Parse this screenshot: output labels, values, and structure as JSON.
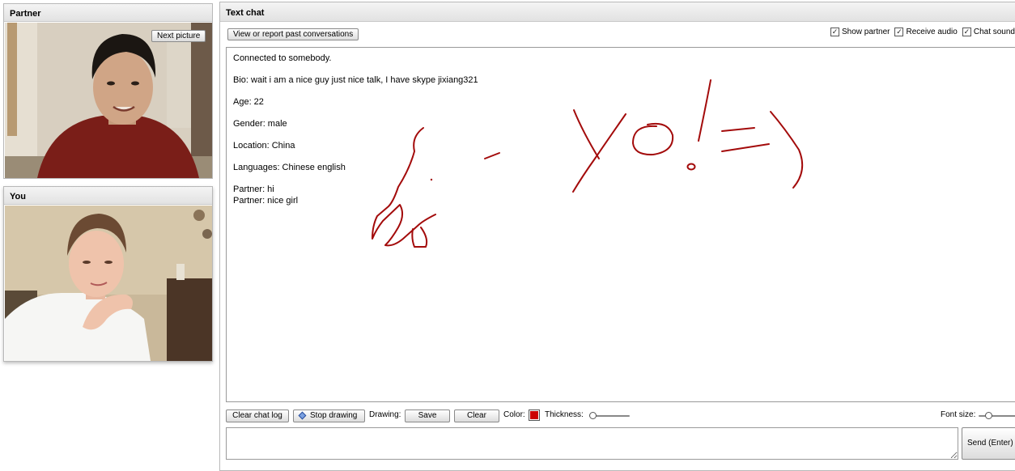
{
  "partner": {
    "title": "Partner",
    "next_picture_label": "Next picture"
  },
  "you": {
    "title": "You"
  },
  "chat": {
    "title": "Text chat",
    "history_button": "View or report past conversations",
    "options": [
      {
        "label": "Show partner",
        "checked": true
      },
      {
        "label": "Receive audio",
        "checked": true
      },
      {
        "label": "Chat sound",
        "checked": true
      }
    ],
    "log": {
      "connected": "Connected to somebody.",
      "bio": "Bio: wait i am a nice guy just nice talk, I have skype jixiang321",
      "age": "Age: 22",
      "gender": "Gender: male",
      "location": "Location: China",
      "languages": "Languages: Chinese english",
      "messages": [
        "Partner: hi",
        "Partner: nice girl"
      ]
    },
    "drawing_color": "#a30b0b"
  },
  "toolbar": {
    "clear_log_label": "Clear chat log",
    "stop_drawing_label": "Stop drawing",
    "drawing_label": "Drawing:",
    "save_label": "Save",
    "clear_label": "Clear",
    "color_label": "Color:",
    "thickness_label": "Thickness:",
    "font_size_label": "Font size:",
    "pen_color": "#cc0000"
  },
  "composer": {
    "message": "",
    "send_label": "Send (Enter)"
  }
}
